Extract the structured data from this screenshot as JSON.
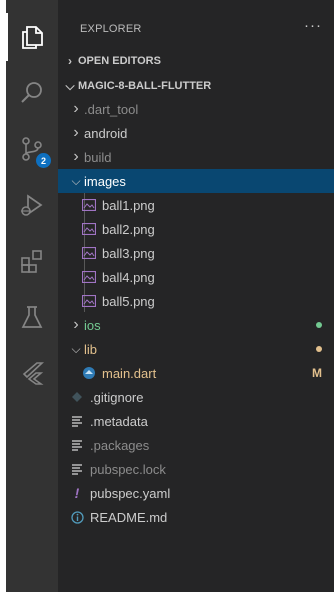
{
  "colors": {
    "activity_bg": "#333333",
    "sidebar_bg": "#252526",
    "selection": "#094771",
    "badge": "#0e70c0",
    "git_added": "#73c991",
    "git_modified": "#e2c08d",
    "ignored_text": "#8c8c8c"
  },
  "activity_bar": {
    "items": [
      {
        "icon": "files-icon"
      },
      {
        "icon": "search-icon"
      },
      {
        "icon": "source-control-icon",
        "badge": "2"
      },
      {
        "icon": "run-debug-icon"
      },
      {
        "icon": "extensions-icon"
      },
      {
        "icon": "testing-icon"
      },
      {
        "icon": "flutter-icon"
      }
    ]
  },
  "explorer": {
    "title": "EXPLORER",
    "more": "···",
    "open_editors": "OPEN EDITORS",
    "project": "MAGIC-8-BALL-FLUTTER",
    "tree": [
      {
        "label": ".dart_tool",
        "type": "folder",
        "state": "collapsed"
      },
      {
        "label": "android",
        "type": "folder",
        "state": "collapsed"
      },
      {
        "label": "build",
        "type": "folder",
        "state": "collapsed"
      },
      {
        "label": "images",
        "type": "folder",
        "state": "expanded"
      },
      {
        "label": "ball1.png",
        "type": "image"
      },
      {
        "label": "ball2.png",
        "type": "image"
      },
      {
        "label": "ball3.png",
        "type": "image"
      },
      {
        "label": "ball4.png",
        "type": "image"
      },
      {
        "label": "ball5.png",
        "type": "image"
      },
      {
        "label": "ios",
        "type": "folder",
        "state": "collapsed",
        "status": "added"
      },
      {
        "label": "lib",
        "type": "folder",
        "state": "expanded",
        "status": "modified"
      },
      {
        "label": "main.dart",
        "type": "dart",
        "status": "modified",
        "mark": "M"
      },
      {
        "label": ".gitignore",
        "type": "gitignore"
      },
      {
        "label": ".metadata",
        "type": "text"
      },
      {
        "label": ".packages",
        "type": "text"
      },
      {
        "label": "pubspec.lock",
        "type": "text"
      },
      {
        "label": "pubspec.yaml",
        "type": "yaml"
      },
      {
        "label": "README.md",
        "type": "info"
      }
    ]
  }
}
